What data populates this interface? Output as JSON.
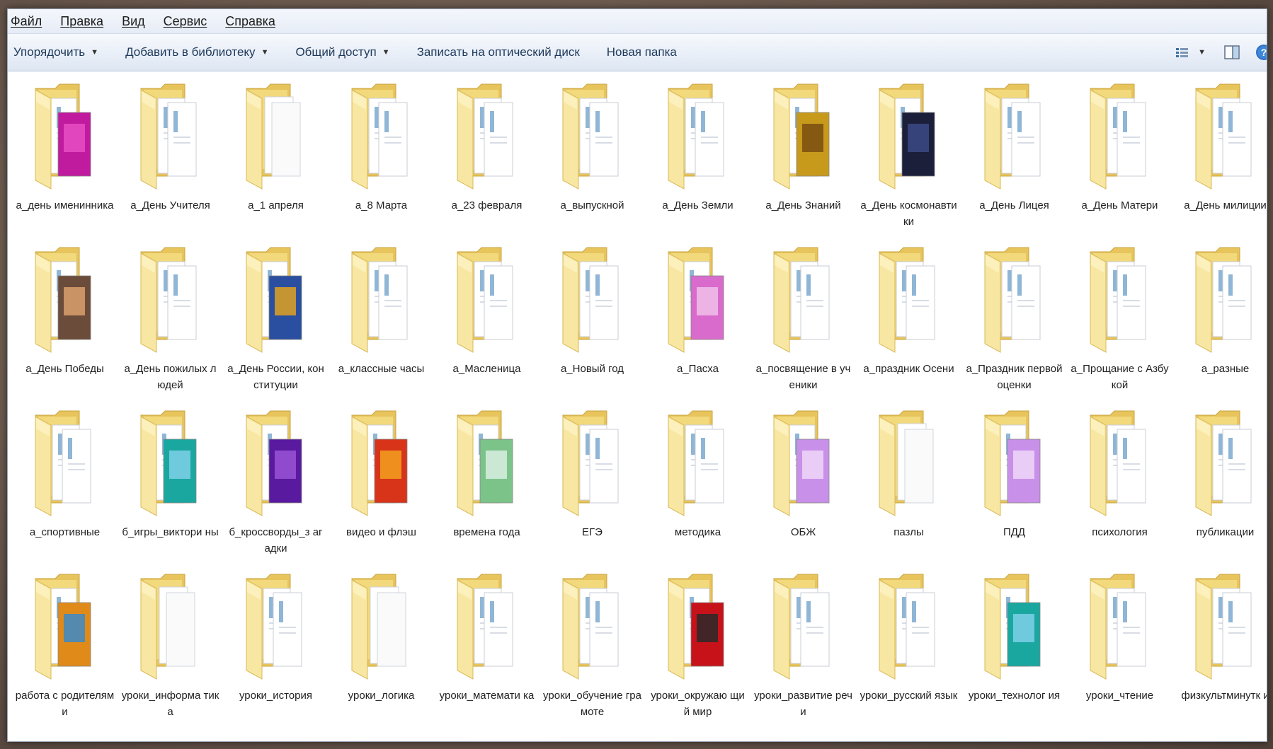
{
  "menu": [
    "Файл",
    "Правка",
    "Вид",
    "Сервис",
    "Справка"
  ],
  "toolbar": {
    "organize": "Упорядочить",
    "add_library": "Добавить в библиотеку",
    "share": "Общий доступ",
    "burn": "Записать на оптический диск",
    "new_folder": "Новая папка"
  },
  "colors": {
    "folder_back": "#e7c45c",
    "folder_front": "#f8e7a2",
    "toolbar_text": "#1e395b"
  },
  "folders": [
    {
      "name": "а_день именинника",
      "art": "magenta"
    },
    {
      "name": "а_День Учителя",
      "art": "doc"
    },
    {
      "name": "а_1 апреля",
      "art": "plain"
    },
    {
      "name": "а_8 Марта",
      "art": "doc"
    },
    {
      "name": "а_23 февраля",
      "art": "doc"
    },
    {
      "name": "а_выпускной",
      "art": "doc"
    },
    {
      "name": "а_День Земли",
      "art": "doc"
    },
    {
      "name": "а_День Знаний",
      "art": "yellow"
    },
    {
      "name": "а_День космонавтики",
      "art": "dark"
    },
    {
      "name": "а_День Лицея",
      "art": "doc"
    },
    {
      "name": "а_День Матери",
      "art": "doc"
    },
    {
      "name": "а_День милиции",
      "art": "doc"
    },
    {
      "name": "а_День Победы",
      "art": "photo"
    },
    {
      "name": "а_День пожилых людей",
      "art": "doc"
    },
    {
      "name": "а_День России, конституции",
      "art": "blue"
    },
    {
      "name": "а_классные часы",
      "art": "doc"
    },
    {
      "name": "а_Масленица",
      "art": "doc"
    },
    {
      "name": "а_Новый год",
      "art": "doc"
    },
    {
      "name": "а_Пасха",
      "art": "pink"
    },
    {
      "name": "а_посвящение в ученики",
      "art": "doc"
    },
    {
      "name": "а_праздник Осени",
      "art": "doc"
    },
    {
      "name": "а_Праздник первой оценки",
      "art": "doc"
    },
    {
      "name": "а_Прощание с Азбукой",
      "art": "doc"
    },
    {
      "name": "а_разные",
      "art": "doc"
    },
    {
      "name": "а_спортивные",
      "art": "doc"
    },
    {
      "name": "б_игры_виктори ны",
      "art": "teal"
    },
    {
      "name": "б_кроссворды_з агадки",
      "art": "purple"
    },
    {
      "name": "видео и флэш",
      "art": "red"
    },
    {
      "name": "времена года",
      "art": "green"
    },
    {
      "name": "ЕГЭ",
      "art": "doc"
    },
    {
      "name": "методика",
      "art": "doc"
    },
    {
      "name": "ОБЖ",
      "art": "lilac"
    },
    {
      "name": "пазлы",
      "art": "plain"
    },
    {
      "name": "ПДД",
      "art": "lilac"
    },
    {
      "name": "психология",
      "art": "doc"
    },
    {
      "name": "публикации",
      "art": "doc"
    },
    {
      "name": "работа с родителями",
      "art": "autumn"
    },
    {
      "name": "уроки_информа тика",
      "art": "plain"
    },
    {
      "name": "уроки_история",
      "art": "doc"
    },
    {
      "name": "уроки_логика",
      "art": "plain"
    },
    {
      "name": "уроки_математи ка",
      "art": "doc"
    },
    {
      "name": "уроки_обучение грамоте",
      "art": "doc"
    },
    {
      "name": "уроки_окружаю щий мир",
      "art": "redbook"
    },
    {
      "name": "уроки_развитие речи",
      "art": "doc"
    },
    {
      "name": "уроки_русский язык",
      "art": "doc"
    },
    {
      "name": "уроки_технолог ия",
      "art": "teal"
    },
    {
      "name": "уроки_чтение",
      "art": "doc"
    },
    {
      "name": "физкультминутк и",
      "art": "doc"
    }
  ]
}
